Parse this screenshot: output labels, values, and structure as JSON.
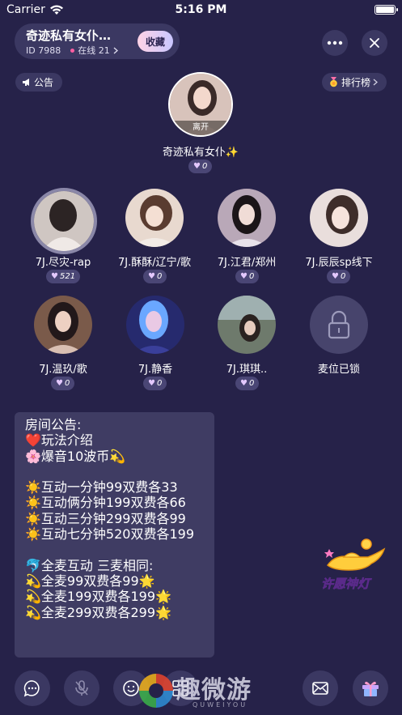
{
  "status_bar": {
    "carrier": "Carrier",
    "time": "5:16 PM"
  },
  "room": {
    "name": "奇迹私有女仆…",
    "id_text": "ID 7988",
    "online_text": "在线 21",
    "favorite_label": "收藏"
  },
  "announcement_tag": "公告",
  "ranking_tag": "排行榜",
  "host": {
    "name": "奇迹私有女仆✨",
    "status": "离开",
    "hearts": "0"
  },
  "seats": [
    {
      "name": "7J.尽灾-rap",
      "hearts": "521"
    },
    {
      "name": "7J.酥酥/辽宁/歌",
      "hearts": "0"
    },
    {
      "name": "7J.江君/郑州",
      "hearts": "0"
    },
    {
      "name": "7J.辰辰sp线下",
      "hearts": "0"
    },
    {
      "name": "7J.温玖/歌",
      "hearts": "0"
    },
    {
      "name": "7J.静香",
      "hearts": "0"
    },
    {
      "name": "7J.琪琪..",
      "hearts": "0"
    },
    {
      "name": "麦位已锁"
    }
  ],
  "notice": {
    "lines": [
      "房间公告:",
      "❤️玩法介绍",
      "🌸爆音10波币💫",
      "",
      "☀️互动一分钟99双费各33",
      "☀️互动俩分钟199双费各66",
      "☀️互动三分钟299双费各99",
      "☀️互动七分钟520双费各199",
      "",
      "🐬全麦互动 三麦相同:",
      "💫全麦99双费各99🌟",
      "💫全麦199双费各199🌟",
      "💫全麦299双费各299🌟"
    ]
  },
  "lamp": {
    "label": "许愿神灯"
  },
  "watermark": {
    "text": "趣微游",
    "sub": "QUWEIYOU"
  },
  "colors": {
    "background": "#262249",
    "panel": "#3b3862",
    "accent_pink": "#ff5fa2"
  }
}
